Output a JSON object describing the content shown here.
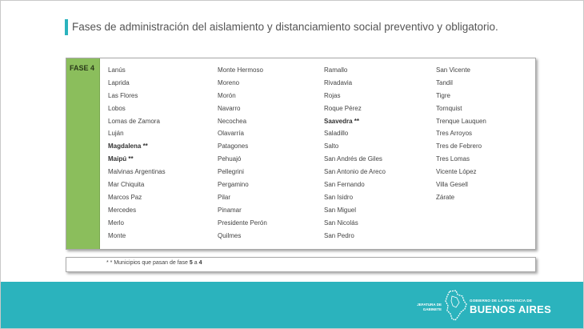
{
  "header": {
    "title": "Fases de administración del aislamiento y distanciamiento social preventivo y obligatorio."
  },
  "table": {
    "phase_label": "FASE 4",
    "columns": [
      [
        {
          "name": "Lanús",
          "bold": false
        },
        {
          "name": "Laprida",
          "bold": false
        },
        {
          "name": "Las Flores",
          "bold": false
        },
        {
          "name": "Lobos",
          "bold": false
        },
        {
          "name": "Lomas de Zamora",
          "bold": false
        },
        {
          "name": "Luján",
          "bold": false
        },
        {
          "name": "Magdalena **",
          "bold": true
        },
        {
          "name": "Maipú **",
          "bold": true
        },
        {
          "name": "Malvinas Argentinas",
          "bold": false
        },
        {
          "name": "Mar Chiquita",
          "bold": false
        },
        {
          "name": "Marcos Paz",
          "bold": false
        },
        {
          "name": "Mercedes",
          "bold": false
        },
        {
          "name": "Merlo",
          "bold": false
        },
        {
          "name": "Monte",
          "bold": false
        }
      ],
      [
        {
          "name": "Monte Hermoso",
          "bold": false
        },
        {
          "name": "Moreno",
          "bold": false
        },
        {
          "name": "Morón",
          "bold": false
        },
        {
          "name": "Navarro",
          "bold": false
        },
        {
          "name": "Necochea",
          "bold": false
        },
        {
          "name": "Olavarría",
          "bold": false
        },
        {
          "name": "Patagones",
          "bold": false
        },
        {
          "name": "Pehuajó",
          "bold": false
        },
        {
          "name": "Pellegrini",
          "bold": false
        },
        {
          "name": "Pergamino",
          "bold": false
        },
        {
          "name": "Pilar",
          "bold": false
        },
        {
          "name": "Pinamar",
          "bold": false
        },
        {
          "name": "Presidente Perón",
          "bold": false
        },
        {
          "name": "Quilmes",
          "bold": false
        }
      ],
      [
        {
          "name": "Ramallo",
          "bold": false
        },
        {
          "name": "Rivadavia",
          "bold": false
        },
        {
          "name": "Rojas",
          "bold": false
        },
        {
          "name": "Roque Pérez",
          "bold": false
        },
        {
          "name": "Saavedra **",
          "bold": true
        },
        {
          "name": "Saladillo",
          "bold": false
        },
        {
          "name": "Salto",
          "bold": false
        },
        {
          "name": "San Andrés de Giles",
          "bold": false
        },
        {
          "name": "San Antonio de Areco",
          "bold": false
        },
        {
          "name": "San Fernando",
          "bold": false
        },
        {
          "name": "San Isidro",
          "bold": false
        },
        {
          "name": "San Miguel",
          "bold": false
        },
        {
          "name": "San Nicolás",
          "bold": false
        },
        {
          "name": "San Pedro",
          "bold": false
        }
      ],
      [
        {
          "name": "San Vicente",
          "bold": false
        },
        {
          "name": "Tandil",
          "bold": false
        },
        {
          "name": "Tigre",
          "bold": false
        },
        {
          "name": "Tornquist",
          "bold": false
        },
        {
          "name": "Trenque Lauquen",
          "bold": false
        },
        {
          "name": "Tres Arroyos",
          "bold": false
        },
        {
          "name": "Tres de Febrero",
          "bold": false
        },
        {
          "name": "Tres Lomas",
          "bold": false
        },
        {
          "name": "Vicente López",
          "bold": false
        },
        {
          "name": "Villa Gesell",
          "bold": false
        },
        {
          "name": "Zárate",
          "bold": false
        }
      ]
    ]
  },
  "footnote": {
    "prefix": "* * Municipios que pasan de fase",
    "from_phase": "5",
    "connector": "a",
    "to_phase": "4"
  },
  "footer": {
    "jefatura_line1": "JEFATURA DE",
    "jefatura_line2": "GABINETE",
    "gov_small": "GOBIERNO DE LA PROVINCIA DE",
    "gov_big": "BUENOS AIRES",
    "color": "#2bb3bd"
  },
  "colors": {
    "accent": "#2bb3bd",
    "phase_green": "#8bbe5c"
  }
}
